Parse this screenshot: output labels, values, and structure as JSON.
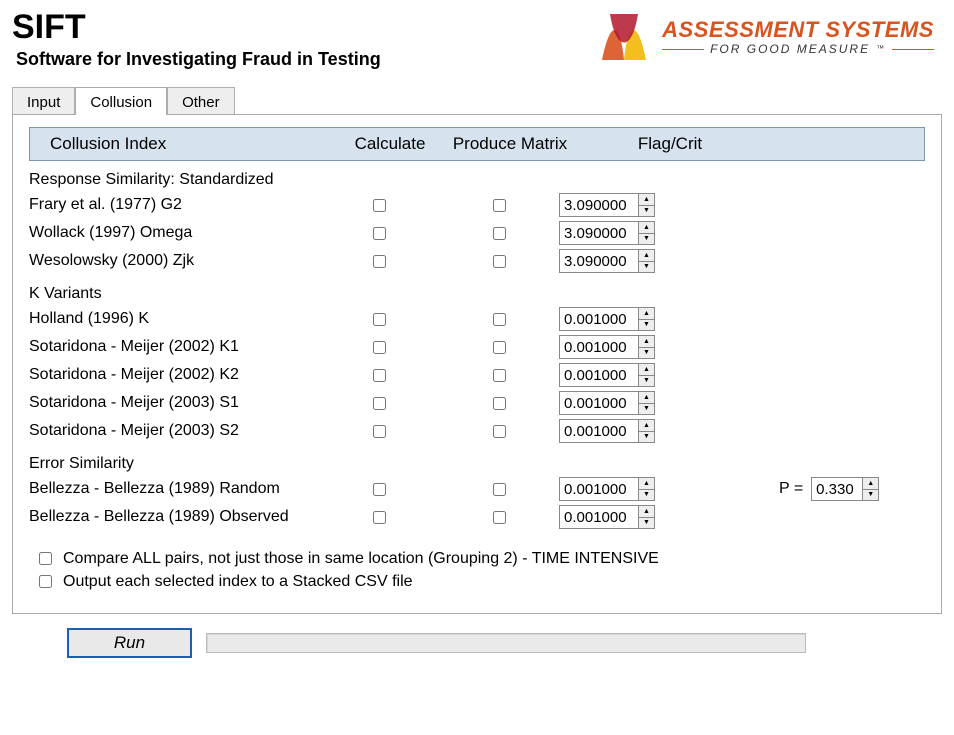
{
  "app": {
    "title": "SIFT",
    "subtitle": "Software for Investigating Fraud in Testing"
  },
  "brand": {
    "line1": "ASSESSMENT SYSTEMS",
    "line2": "FOR GOOD MEASURE"
  },
  "tabs": {
    "input": "Input",
    "collusion": "Collusion",
    "other": "Other",
    "active": "collusion"
  },
  "headers": {
    "index": "Collusion Index",
    "calculate": "Calculate",
    "produce": "Produce Matrix",
    "flag": "Flag/Crit"
  },
  "sections": {
    "rss": "Response Similarity: Standardized",
    "kvar": "K Variants",
    "esim": "Error Similarity"
  },
  "rows": {
    "frary": {
      "label": "Frary et al. (1977) G2",
      "value": "3.090000"
    },
    "wollack": {
      "label": "Wollack (1997) Omega",
      "value": "3.090000"
    },
    "wesolowsky": {
      "label": "Wesolowsky (2000) Zjk",
      "value": "3.090000"
    },
    "holland": {
      "label": "Holland (1996) K",
      "value": "0.001000"
    },
    "k1": {
      "label": "Sotaridona - Meijer (2002) K1",
      "value": "0.001000"
    },
    "k2": {
      "label": "Sotaridona - Meijer (2002) K2",
      "value": "0.001000"
    },
    "s1": {
      "label": "Sotaridona - Meijer (2003) S1",
      "value": "0.001000"
    },
    "s2": {
      "label": "Sotaridona - Meijer (2003) S2",
      "value": "0.001000"
    },
    "brandom": {
      "label": "Bellezza - Bellezza (1989) Random",
      "value": "0.001000"
    },
    "bobserved": {
      "label": "Bellezza - Bellezza (1989) Observed",
      "value": "0.001000"
    }
  },
  "p": {
    "label": "P =",
    "value": "0.330"
  },
  "options": {
    "compare_all": "Compare ALL pairs, not just those in same location (Grouping 2) - TIME INTENSIVE",
    "output_csv": "Output each selected index to a Stacked CSV file"
  },
  "buttons": {
    "run": "Run"
  }
}
